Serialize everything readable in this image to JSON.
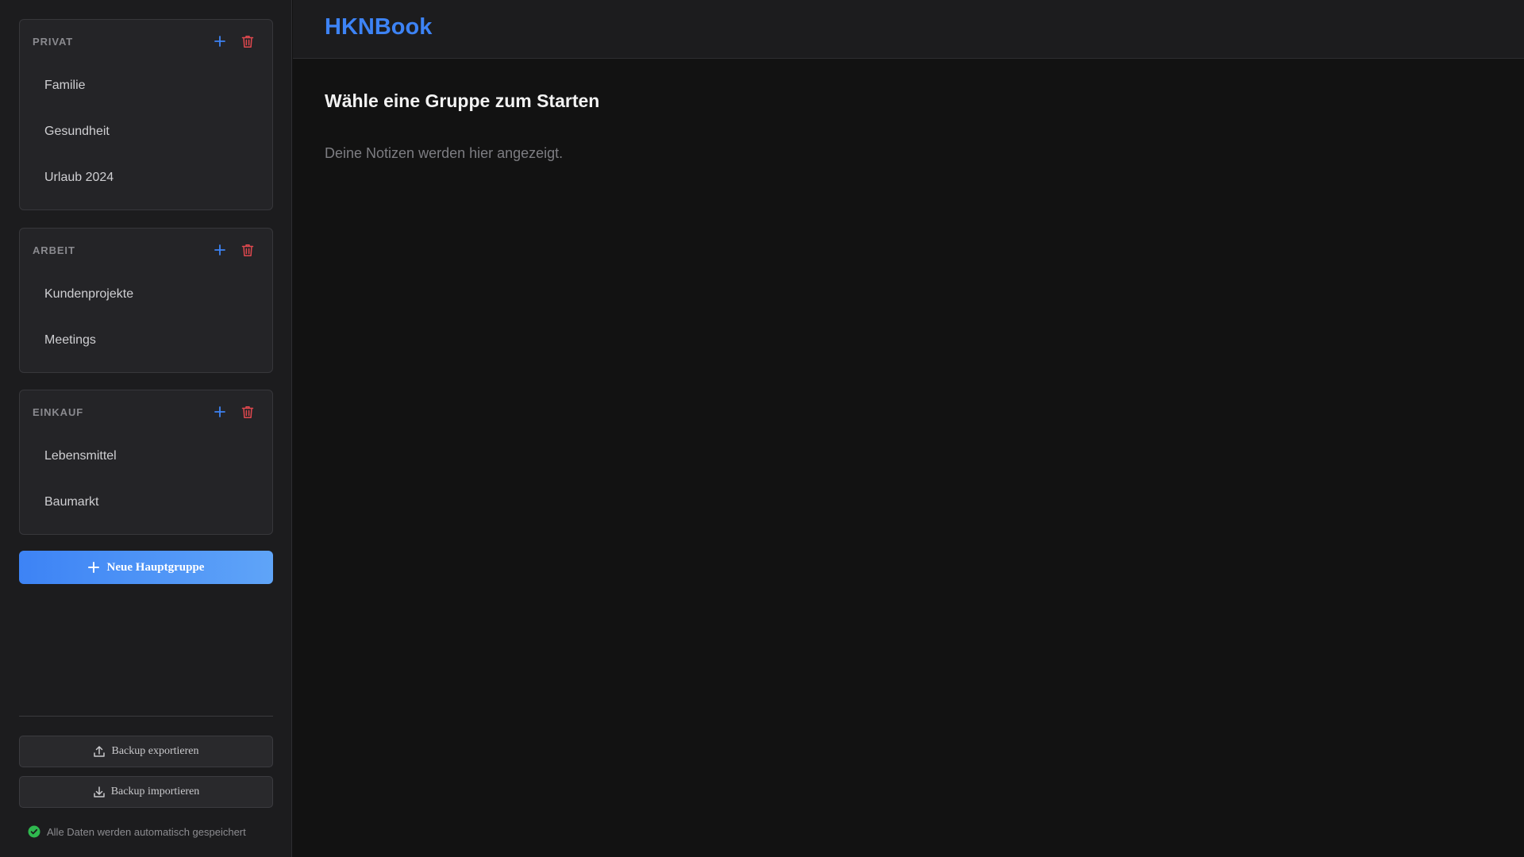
{
  "app": {
    "title": "HKNBook"
  },
  "groups": [
    {
      "title": "PRIVAT",
      "items": [
        "Familie",
        "Gesundheit",
        "Urlaub 2024"
      ]
    },
    {
      "title": "ARBEIT",
      "items": [
        "Kundenprojekte",
        "Meetings"
      ]
    },
    {
      "title": "EINKAUF",
      "items": [
        "Lebensmittel",
        "Baumarkt"
      ]
    }
  ],
  "sidebar": {
    "new_group_label": "Neue Hauptgruppe",
    "export_label": "Backup exportieren",
    "import_label": "Backup importieren",
    "autosave_text": "Alle Daten werden automatisch gespeichert"
  },
  "main": {
    "empty_title": "Wähle eine Gruppe zum Starten",
    "empty_text": "Deine Notizen werden hier angezeigt."
  },
  "colors": {
    "accent": "#3d83f5",
    "danger": "#e0484e",
    "success": "#2fb84f",
    "background": "#121212",
    "sidebar": "#1c1c1e"
  },
  "icons": {
    "add": "plus-icon",
    "delete": "trash-icon",
    "export": "upload-icon",
    "import": "download-icon",
    "saved": "check-circle-icon"
  }
}
